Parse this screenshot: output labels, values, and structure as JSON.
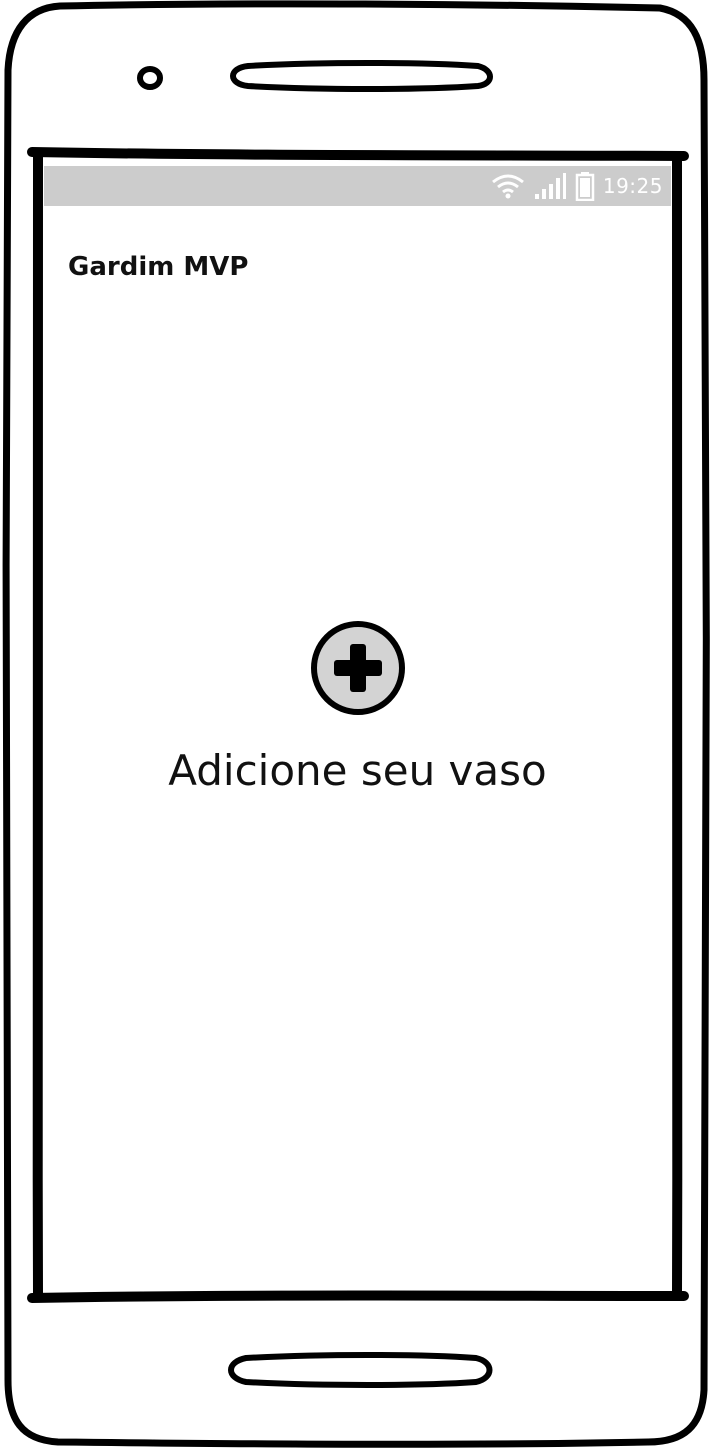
{
  "status_bar": {
    "time": "19:25",
    "icons": [
      "wifi-icon",
      "signal-icon",
      "battery-icon"
    ],
    "background": "#cccccc"
  },
  "app": {
    "title": "Gardim MVP"
  },
  "main": {
    "add_button_icon": "plus-circle-icon",
    "add_label": "Adicione seu vaso"
  },
  "colors": {
    "outline": "#000000",
    "button_fill": "#d3d3d3",
    "status_bar": "#cccccc"
  }
}
